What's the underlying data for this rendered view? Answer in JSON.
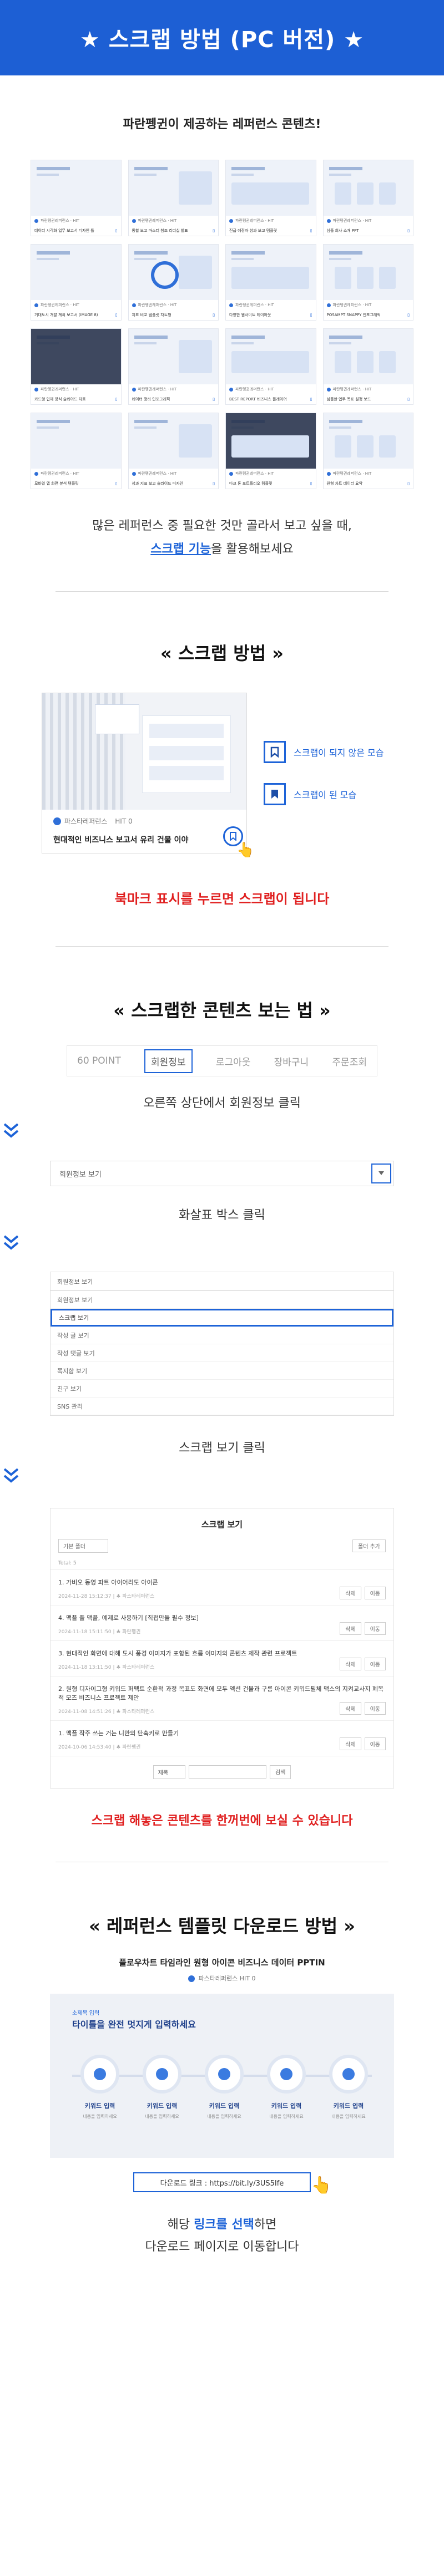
{
  "banner": {
    "title": "★ 스크랩 방법 (PC 버전) ★"
  },
  "intro": {
    "headline": "파란펭귄이 제공하는 레퍼런스 콘텐츠!",
    "line1": "많은 레퍼런스 중 필요한 것만 골라서 보고 싶을 때,",
    "line2_blue": "스크랩 기능",
    "line2_rest": "을 활용해보세요"
  },
  "thumb_caps": [
    "데이터 시각화 업무 보고서 디자인 틀",
    "통합 보고 마스터 참조 리더십 발표",
    "진급 예정자 성과 보고 템플릿",
    "심플 회사 소개 PPT",
    "거대도시 개발 계획 보고서 (IMAGE 8)",
    "지표 비교 템플릿 차트형",
    "다양한 웹사이트 레이아웃",
    "POSAMPT SNAPPY 인포그래픽",
    "카드형 입체 방식 슬라이드 차트",
    "데이터 정리 인포그래픽",
    "BEST REPORT 비즈니스 플레이어",
    "심플한 업무 목표 설정 보드",
    "모바일 앱 화면 분석 템플릿",
    "성과 지표 보고 슬라이드 디자인",
    "다크 톤 포트폴리오 템플릿",
    "원형 차트 데이터 요약"
  ],
  "thumb_meta": "파란펭귄레퍼런스 · HIT",
  "sec1": {
    "title": "« 스크랩 방법 »",
    "card_brand": "파스타레퍼런스",
    "card_hit": "HIT 0",
    "card_title": "현대적인 비즈니스 보고서 유리 건물 이야",
    "legend_off": "스크랩이 되지 않은 모습",
    "legend_on": "스크랩이 된 모습",
    "note": "북마크 표시를 누르면 스크랩이 됩니다"
  },
  "sec2": {
    "title": "« 스크랩한 콘텐츠 보는 법 »",
    "tabs": [
      "60 POINT",
      "회원정보",
      "로그아웃",
      "장바구니",
      "주문조회"
    ],
    "step1": "오른쪽 상단에서 회원정보 클릭",
    "select_value": "회원정보 보기",
    "step2": "화살표 박스 클릭",
    "menu_head": "회원정보 보기",
    "menu": [
      "회원정보 보기",
      "스크랩 보기",
      "작성 글 보기",
      "작성 댓글 보기",
      "쪽지함 보기",
      "친구 보기",
      "SNS 관리"
    ],
    "step3": "스크랩 보기 클릭",
    "list_title": "스크랩 보기",
    "list_filter": "기본 폴더",
    "list_filter_btn": "폴더 추가",
    "list_total": "Total: 5",
    "rows": [
      {
        "t": "1. 가비오 동영 파트 아이어리도 아이콘",
        "s": "2024-11-28 15:12:37 | ♣ 파스타레퍼런스"
      },
      {
        "t": "4. 맥플 플 맥플, 예제로 사용하기 [직접만들 필수 정보]",
        "s": "2024-11-18 15:11:50 | ♣ 파란펭귄"
      },
      {
        "t": "3. 현대적인 화면에 대해 도시 풍경 이미지가 포함된 흐름 이미지의 콘텐츠 제작 관련 프로젝트",
        "s": "2024-11-18 13:11:50 | ♣ 파스타레퍼런스"
      },
      {
        "t": "2. 원형 디자이그형 키워드 퍼펙트 순환적 과정 목표도 화면에 모두 엑션 건물과 구름 아이콘 키워드필체 맥스의 지켜교사지 폐목적 모즈 비즈니스 프로젝트 제안",
        "s": "2024-11-08 14:51:26 | ♣ 파스타레퍼런스"
      },
      {
        "t": "1. 맥플 작주 쓰는 거는 니만의 단축키로 만들기",
        "s": "2024-10-06 14:53:40 | ♣ 파란펭귄"
      }
    ],
    "btn_del": "삭제",
    "btn_move": "이동",
    "search_opt": "제목",
    "search_btn": "검색",
    "note": "스크랩 해놓은 콘텐츠를 한꺼번에 보실 수 있습니다"
  },
  "sec3": {
    "title": "« 레퍼런스 템플릿 다운로드 방법 »",
    "product": "플로우차트 타임라인 원형 아이콘 비즈니스 데이터 PPTIN",
    "product_meta": "파스타레퍼런스   HIT 0",
    "slide_label": "소제목 입력",
    "slide_title": "타이틀을 완전 멋지게 입력하세요",
    "keyword": "키워드 입력",
    "keyword_desc": "내용을 입력하세요",
    "link_label": "다운로드 링크 : https://bit.ly/3US5Ife",
    "note_pre": "해당 ",
    "note_blue": "링크를 선택",
    "note_post": "하면",
    "note_line2": "다운로드 페이지로 이동합니다"
  },
  "colors": {
    "brand": "#1d5fd4",
    "accent": "#1d63d8",
    "alert": "#e02020"
  }
}
